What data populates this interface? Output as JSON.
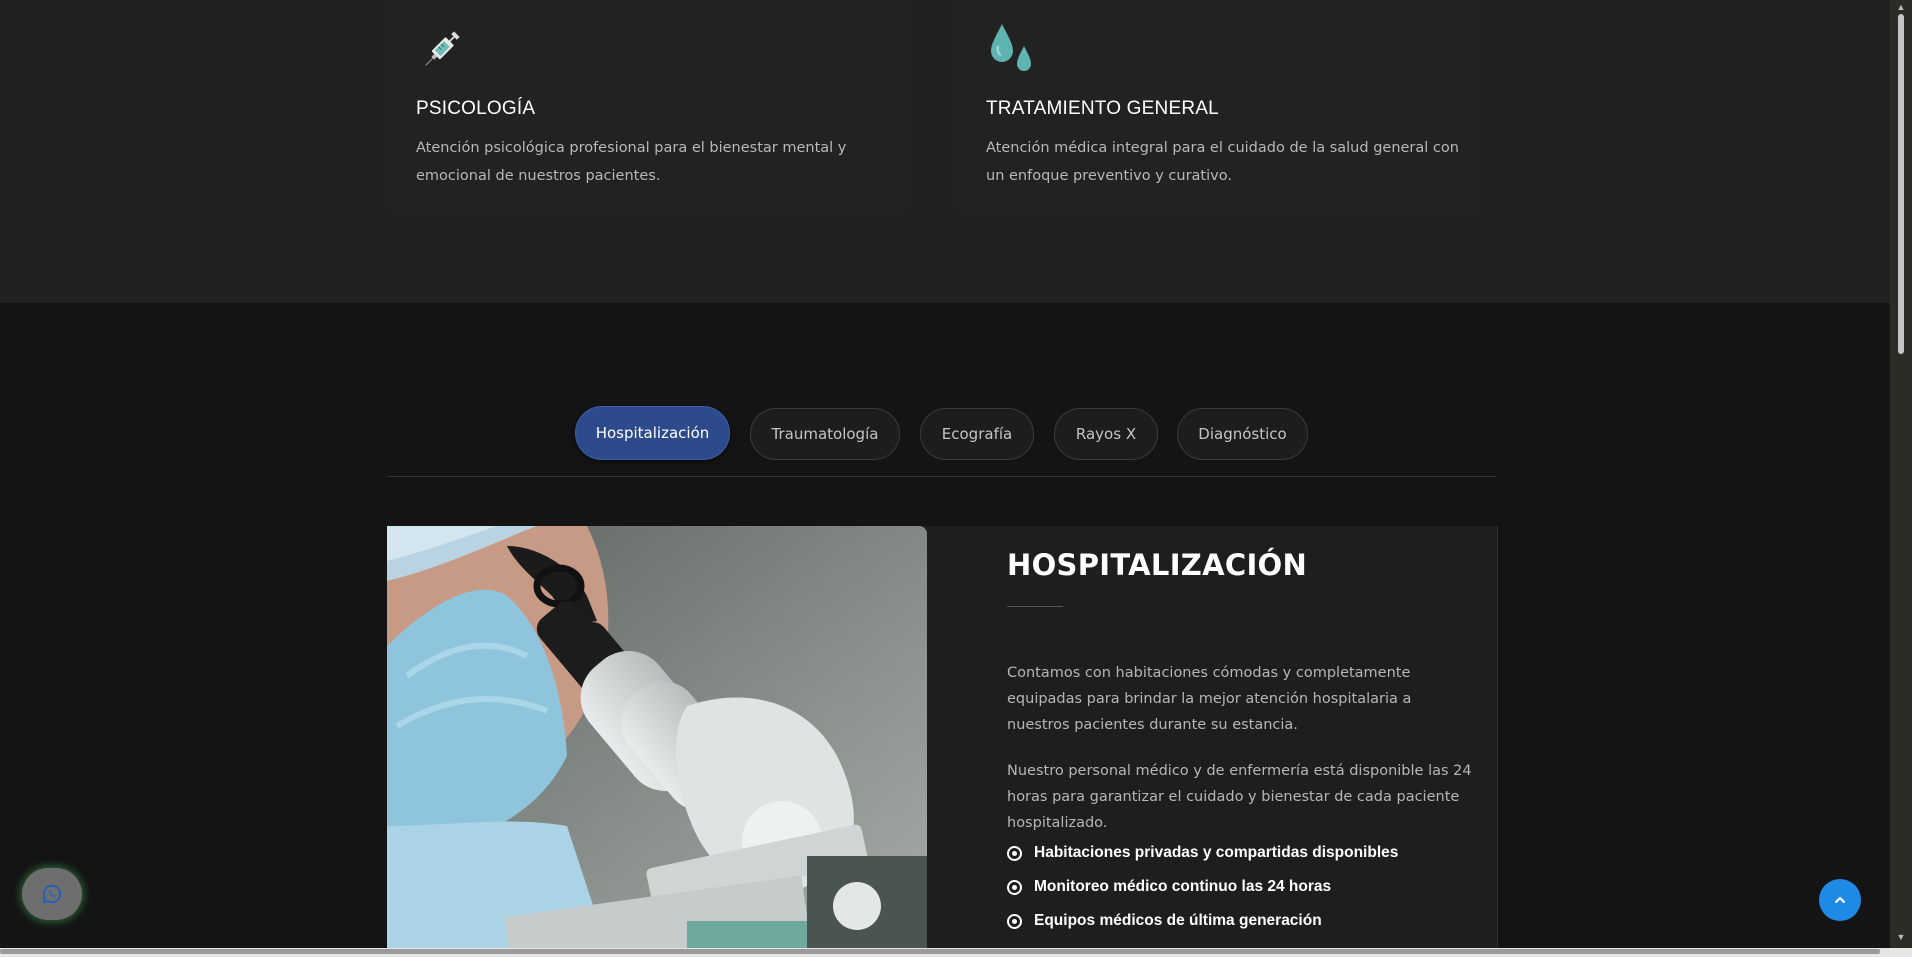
{
  "services": [
    {
      "icon": "syringe-icon",
      "title": "PSICOLOGÍA",
      "description": "Atención psicológica profesional para el bienestar mental y emocional de nuestros pacientes."
    },
    {
      "icon": "water-drops-icon",
      "title": "TRATAMIENTO GENERAL",
      "description": "Atención médica integral para el cuidado de la salud general con un enfoque preventivo y curativo."
    }
  ],
  "tabs": [
    {
      "label": "Hospitalización",
      "active": true
    },
    {
      "label": "Traumatología",
      "active": false
    },
    {
      "label": "Ecografía",
      "active": false
    },
    {
      "label": "Rayos X",
      "active": false
    },
    {
      "label": "Diagnóstico",
      "active": false
    }
  ],
  "detail": {
    "title": "HOSPITALIZACIÓN",
    "paragraphs": [
      "Contamos con habitaciones cómodas y completamente equipadas para brindar la mejor atención hospitalaria a nuestros pacientes durante su estancia.",
      "Nuestro personal médico y de enfermería está disponible las 24 horas para garantizar el cuidado y bienestar de cada paciente hospitalizado."
    ],
    "features": [
      "Habitaciones privadas y compartidas disponibles",
      "Monitoreo médico continuo las 24 horas",
      "Equipos médicos de última generación"
    ],
    "image": "doctor-microscope-photo"
  },
  "floating": {
    "whatsapp_icon": "whatsapp-icon",
    "scroll_top_icon": "chevron-up-icon"
  },
  "colors": {
    "accent": "#2c4a8c",
    "scroll_top": "#1f8ae6",
    "icon_teal": "#5fb3b0"
  }
}
